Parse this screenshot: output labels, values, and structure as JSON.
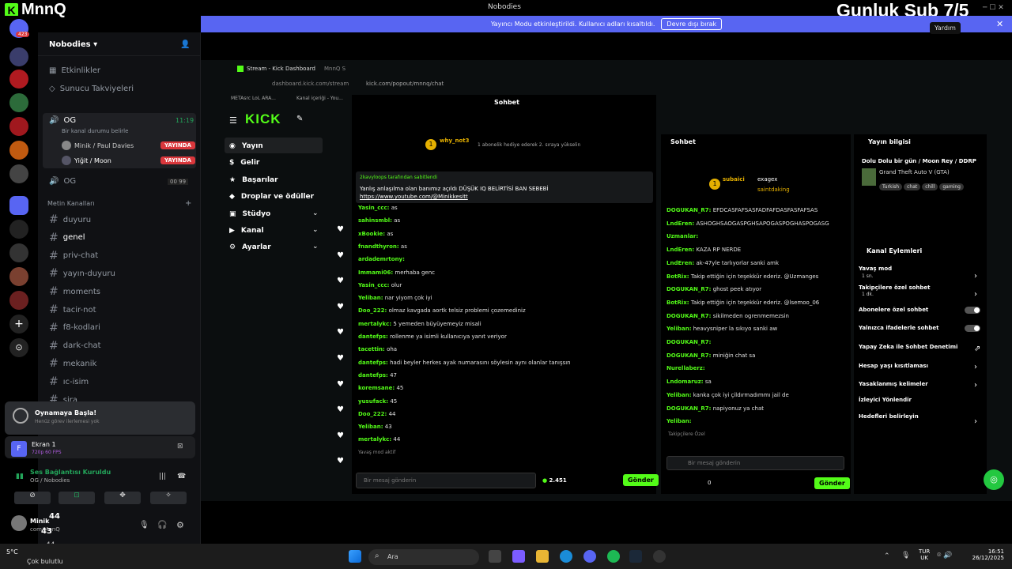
{
  "window": {
    "brand": "MnnQ",
    "title": "Nobodies",
    "overlay": "Gunluk Sub 7/5",
    "tooltip": "Yardım"
  },
  "banner": {
    "text": "Yayıncı Modu etkinleştirildi. Kullanıcı adları kısaltıldı.",
    "button": "Devre dışı bırak"
  },
  "rail": {
    "badge": "423"
  },
  "server": {
    "name": "Nobodies",
    "items": [
      "Etkinlikler",
      "Sunucu Takviyeleri"
    ]
  },
  "voice": {
    "channel": "OG",
    "time": "11:19",
    "status": "Bir kanal durumu belirle",
    "users": [
      {
        "name": "Minik / Paul Davies",
        "badge": "YAYINDA"
      },
      {
        "name": "Yiğit / Moon",
        "badge": "YAYINDA"
      }
    ],
    "channel2": "OG",
    "count": "00",
    "limit": "99"
  },
  "category": "Metin Kanalları",
  "channels": [
    "duyuru",
    "genel",
    "priv-chat",
    "yayın-duyuru",
    "moments",
    "tacir-not",
    "f8-kodlari",
    "dark-chat",
    "mekanik",
    "ıc-isim",
    "sira"
  ],
  "activity": {
    "title": "Oynamaya Başla!",
    "sub": "Henüz görev ilerlemesi yok"
  },
  "screen": {
    "title": "Ekran 1",
    "sub": "720p 60 FPS"
  },
  "vc": {
    "title": "Ses Bağlantısı Kuruldu",
    "sub": "OG / Nobodies"
  },
  "user": {
    "name": "Minik",
    "sub": "com/MnnQ",
    "ov1": "44",
    "ov2": "43",
    "ov3": "44"
  },
  "weather": {
    "temp": "5°C",
    "desc": "Çok bulutlu"
  },
  "browser": {
    "tab1": "Stream - Kick Dashboard",
    "tab2": "MnnQ S",
    "url1": "dashboard.kick.com/stream",
    "url2": "kick.com/popout/mnnq/chat",
    "bm1": "METAsrc LoL ARA...",
    "bm2": "Kanal içeriği - You..."
  },
  "kick": {
    "logo": "KICK",
    "nav": [
      "Yayın",
      "Gelir",
      "Başarılar",
      "Droplar ve ödüller",
      "Stüdyo",
      "Kanal",
      "Ayarlar"
    ]
  },
  "chat1": {
    "title": "Sohbet",
    "gifter": "why_not3",
    "gift": "1 abonelik hediye ederek 2. sıraya yükselin",
    "pinned_by": "2kavyloops tarafından sabitlendi",
    "pinned": "Yanlış anlaşılma olan banımız açıldı DÜŞÜK IQ BELİRTİSİ BAN SEBEBİ",
    "link": "https://www.youtube.com/@Minikkesitt",
    "msgs": [
      [
        "Yasin_ccc:",
        "as"
      ],
      [
        "sahinsmbl:",
        "as"
      ],
      [
        "xBookie:",
        "as"
      ],
      [
        "fnandthyron:",
        "as"
      ],
      [
        "ardademrtony:",
        ""
      ],
      [
        "Immami06:",
        "merhaba genc"
      ],
      [
        "Yasin_ccc:",
        "olur"
      ],
      [
        "Yeliban:",
        "nar yiyom çok iyi"
      ],
      [
        "Doo_222:",
        "olmaz kavgada aortk telsiz problemi çozemediniz"
      ],
      [
        "mertalykc:",
        "5 yemeden büyüyemeyiz misali"
      ],
      [
        "dantefps:",
        "rollenme ya isimli kullanıcıya yanıt veriyor"
      ],
      [
        "tacettin:",
        "oha"
      ],
      [
        "dantefps:",
        "hadi beyler herkes ayak numarasını söylesin aynı olanlar tanışsın"
      ],
      [
        "dantefps:",
        "47"
      ],
      [
        "koremsane:",
        "45"
      ],
      [
        "yusufack:",
        "45"
      ],
      [
        "Doo_222:",
        "44"
      ],
      [
        "Yeliban:",
        "43"
      ],
      [
        "mertalykc:",
        "44"
      ]
    ],
    "slow": "Yavaş mod aktif",
    "placeholder": "Bir mesaj gönderin",
    "count": "2.451",
    "send": "Gönder"
  },
  "chat2": {
    "title": "Sohbet",
    "gifter": "subaici",
    "g2": "exagex",
    "g3": "saintdaking",
    "msgs": [
      [
        "DOGUKAN_R7:",
        "EFDCASFAFSASFADFAFDASFASFAFSAS"
      ],
      [
        "LndEren:",
        "ASHOGHSAOGASPGHSAPOGASPOGHASPOGASG"
      ],
      [
        "Uzmanlar:",
        ""
      ],
      [
        "LndEren:",
        "KAZA RP NERDE"
      ],
      [
        "LndEren:",
        "ak-47yle tarlıyorlar sanki amk"
      ],
      [
        "BotRix:",
        "Takip ettiğin için teşekkür ederiz. @Uzmanges"
      ],
      [
        "DOGUKAN_R7:",
        "ghost peek atıyor"
      ],
      [
        "BotRix:",
        "Takip ettiğin için teşekkür ederiz. @lsemoo_06"
      ],
      [
        "DOGUKAN_R7:",
        "sikilmeden ogrenmemezsin"
      ],
      [
        "Yeliban:",
        "heavysniper la sıkıyo sanki aw"
      ],
      [
        "DOGUKAN_R7:",
        ""
      ],
      [
        "DOGUKAN_R7:",
        "miniğin chat sa"
      ],
      [
        "Nurellaberz:",
        ""
      ],
      [
        "Lndomaruz:",
        "sa"
      ],
      [
        "Yeliban:",
        "kanka çok iyi çildırmadımmı jail de"
      ],
      [
        "DOGUKAN_R7:",
        "napiyonuz ya chat"
      ],
      [
        "Yeliban:",
        ""
      ]
    ],
    "followers": "Takipçilere Özel",
    "placeholder": "Bir mesaj gönderin",
    "count": "0",
    "send": "Gönder"
  },
  "info": {
    "title": "Yayın bilgisi",
    "stream": "Dolu Dolu bir gün / Moon Rey / DDRP",
    "game": "Grand Theft Auto V (GTA)",
    "tags": [
      "Turkish",
      "chat",
      "chill",
      "gaming"
    ]
  },
  "actions": {
    "title": "Kanal Eylemleri",
    "slow": "Yavaş mod",
    "slow_sub": "1 sn.",
    "items": [
      "Takipçilere özel sohbet",
      "Abonelere özel sohbet",
      "Yalnızca ifadelerle sohbet",
      "Yapay Zeka ile Sohbet Denetimi",
      "Hesap yaşı kısıtlaması",
      "Yasaklanmış kelimeler",
      "İzleyici Yönlendir",
      "Hedefleri belirleyin"
    ],
    "follow_sub": "1 dk."
  },
  "taskbar": {
    "search": "Ara",
    "lang1": "TUR",
    "lang2": "UK",
    "time": "16:51",
    "date": "26/12/2025"
  }
}
